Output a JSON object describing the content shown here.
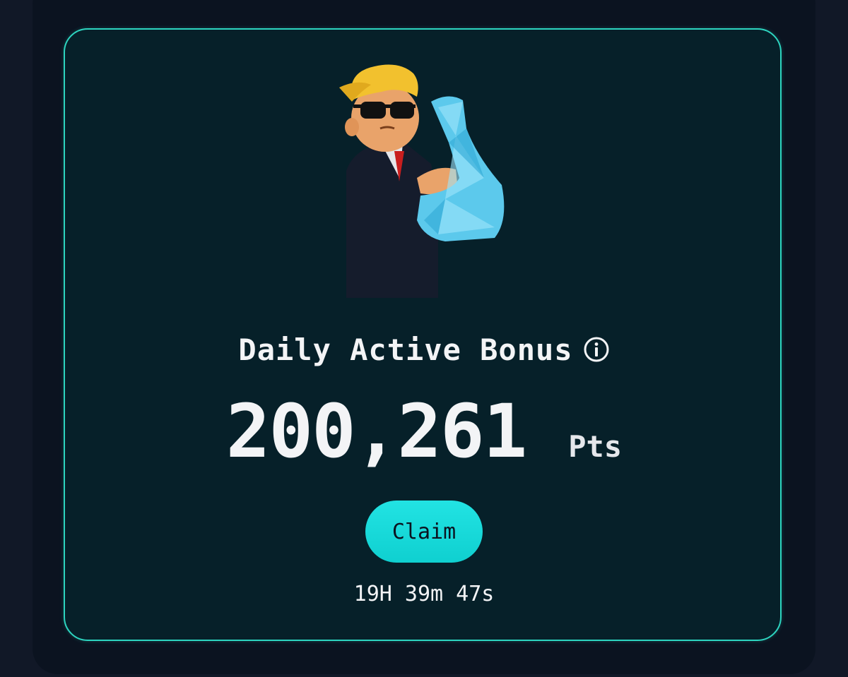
{
  "bonus": {
    "title": "Daily Active Bonus",
    "info_icon": "info-icon",
    "points_value": "200,261",
    "points_unit": "Pts",
    "claim_label": "Claim",
    "countdown": "19H 39m 47s"
  },
  "mascot": {
    "icon": "flexing-businessman-mascot"
  },
  "colors": {
    "background": "#111827",
    "panel": "#0b1320",
    "card": "#062029",
    "card_border": "#2dd4bf",
    "button": "#1edcdc",
    "text": "#f3f4f6"
  }
}
